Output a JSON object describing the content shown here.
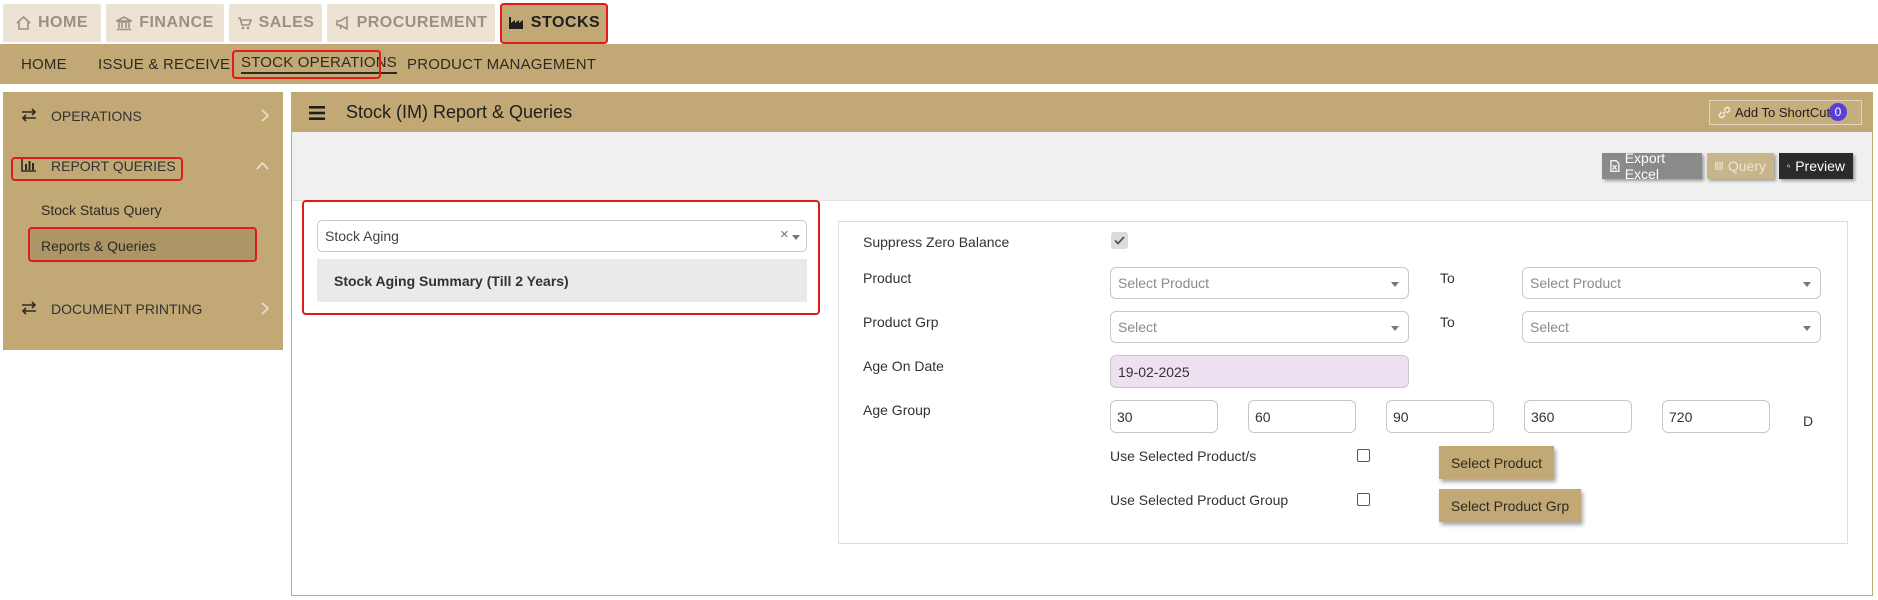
{
  "top_tabs": [
    {
      "label": "HOME",
      "icon": "home-icon",
      "active": false
    },
    {
      "label": "FINANCE",
      "icon": "bank-icon",
      "active": false
    },
    {
      "label": "SALES",
      "icon": "cart-icon",
      "active": false
    },
    {
      "label": "PROCUREMENT",
      "icon": "megaphone-icon",
      "active": false
    },
    {
      "label": "STOCKS",
      "icon": "factory-icon",
      "active": true
    }
  ],
  "sub_nav": [
    {
      "label": "HOME",
      "active": false
    },
    {
      "label": "ISSUE & RECEIVE",
      "active": false
    },
    {
      "label": "STOCK OPERATIONS",
      "active": true
    },
    {
      "label": "PRODUCT MANAGEMENT",
      "active": false
    }
  ],
  "sidebar": {
    "operations": "OPERATIONS",
    "report_queries": "REPORT QUERIES",
    "sub_items": [
      "Stock Status Query",
      "Reports & Queries"
    ],
    "document_printing": "DOCUMENT PRINTING"
  },
  "header": {
    "title": "Stock (IM) Report & Queries",
    "shortcut_label": "Add To ShortCut",
    "shortcut_count": "0"
  },
  "toolbar": {
    "export_label": "Export Excel",
    "query_label": "Query",
    "preview_label": "Preview"
  },
  "report_select": {
    "value": "Stock Aging",
    "clear": "×",
    "options": [
      "Stock Aging Summary (Till 2 Years)"
    ]
  },
  "form": {
    "suppress_label": "Suppress Zero Balance",
    "suppress_checked": true,
    "product_label": "Product",
    "product_placeholder": "Select Product",
    "to_label": "To",
    "product_grp_label": "Product Grp",
    "product_grp_placeholder": "Select",
    "age_on_date_label": "Age On Date",
    "age_on_date": "19-02-2025",
    "age_group_label": "Age Group",
    "age_groups": [
      "30",
      "60",
      "90",
      "360",
      "720"
    ],
    "age_unit": "D",
    "use_selected_product_label": "Use Selected Product/s",
    "use_selected_group_label": "Use Selected Product Group",
    "select_product_button": "Select Product",
    "select_product_grp_button": "Select Product Grp"
  },
  "colors": {
    "tan": "#c1a875",
    "inactive_tab": "#ece3d2",
    "highlight": "#e01b1b",
    "date_field": "#ede0f0"
  }
}
